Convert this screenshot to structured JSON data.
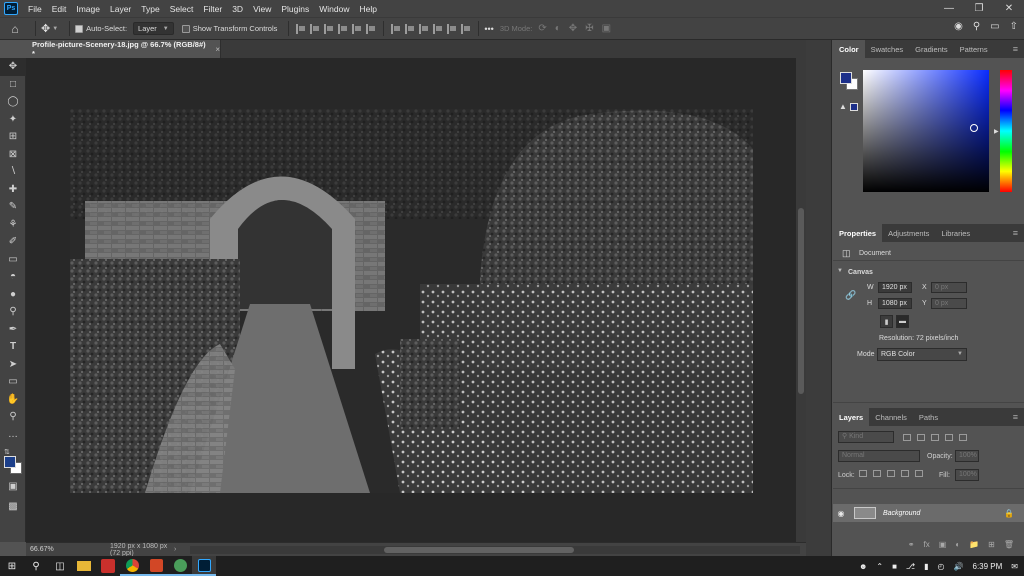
{
  "app": {
    "logo_text": "Ps"
  },
  "menu": [
    "File",
    "Edit",
    "Image",
    "Layer",
    "Type",
    "Select",
    "Filter",
    "3D",
    "View",
    "Plugins",
    "Window",
    "Help"
  ],
  "window_controls": {
    "minimize": "—",
    "restore": "❐",
    "close": "✕"
  },
  "options_bar": {
    "auto_select_label": "Auto-Select:",
    "auto_select_checked": true,
    "auto_select_target": "Layer",
    "transform_controls_label": "Show Transform Controls",
    "transform_controls_checked": false,
    "more_label": "•••",
    "mode_3d_label": "3D Mode:"
  },
  "document": {
    "tab_title": "Profile-picture-Scenery-18.jpg @ 66.7% (RGB/8#) *",
    "close_glyph": "×"
  },
  "status": {
    "zoom": "66.67%",
    "doc_info": "1920 px x 1080 px (72 ppi)"
  },
  "color_panel": {
    "tabs": [
      "Color",
      "Swatches",
      "Gradients",
      "Patterns"
    ],
    "active_tab": "Color",
    "foreground_color": "#1c2f8a",
    "background_color": "#ffffff"
  },
  "properties_panel": {
    "tabs": [
      "Properties",
      "Adjustments",
      "Libraries"
    ],
    "document_label": "Document",
    "canvas_section": "Canvas",
    "width_label": "W",
    "width_value": "1920 px",
    "height_label": "H",
    "height_value": "1080 px",
    "x_label": "X",
    "x_placeholder": "0 px",
    "y_label": "Y",
    "y_placeholder": "0 px",
    "resolution": "Resolution: 72 pixels/inch",
    "mode_label": "Mode",
    "mode_value": "RGB Color"
  },
  "layers_panel": {
    "tabs": [
      "Layers",
      "Channels",
      "Paths"
    ],
    "filter_placeholder": "Kind",
    "blend_mode": "Normal",
    "opacity_label": "Opacity:",
    "opacity_value": "100%",
    "lock_label": "Lock:",
    "fill_label": "Fill:",
    "fill_value": "100%",
    "layers": [
      {
        "name": "Background",
        "visible": true,
        "locked": true
      }
    ]
  },
  "taskbar": {
    "time": "6:39 PM"
  }
}
